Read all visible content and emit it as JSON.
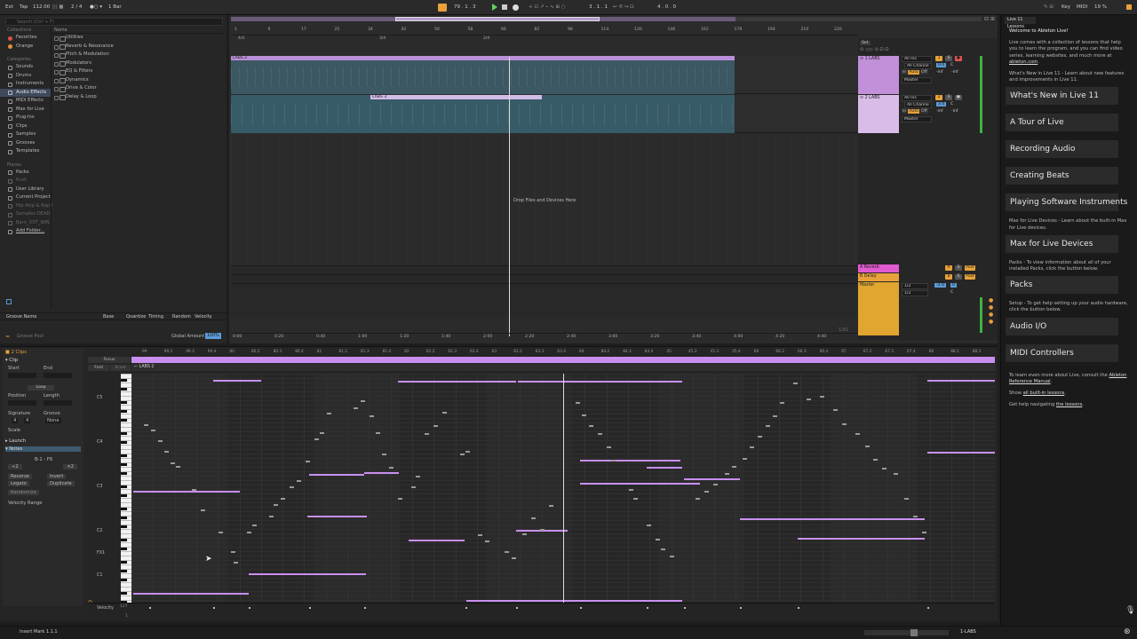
{
  "topbar": {
    "ext": "Ext",
    "tap": "Tap",
    "tempo": "112.00",
    "sig": "2 / 4",
    "quant": "1 Bar",
    "pos": "79 .  1 .  3",
    "loop_pos": "3 .  1 .  1",
    "loop_len": "4 .  0 .  0",
    "key": "Key",
    "midi": "MIDI",
    "cpu": "19 %"
  },
  "browser": {
    "search_placeholder": "Search (Ctrl + F)",
    "collections_h": "Collections",
    "collections": [
      {
        "label": "Favorites",
        "color": "#e05050"
      },
      {
        "label": "Orange",
        "color": "#e0903a"
      }
    ],
    "categories_h": "Categories",
    "categories": [
      "Sounds",
      "Drums",
      "Instruments",
      "Audio Effects",
      "MIDI Effects",
      "Max for Live",
      "Plug-Ins",
      "Clips",
      "Samples",
      "Grooves",
      "Templates"
    ],
    "places_h": "Places",
    "places": [
      "Packs",
      "Push",
      "User Library",
      "Current Project",
      "Hip-Hop & Rap I",
      "Samples DEADI",
      "Barn_VST_WIN",
      "Add Folder..."
    ],
    "name_h": "Name",
    "tree": [
      "Utilities",
      "Reverb & Resonance",
      "Pitch & Modulation",
      "Modulators",
      "EQ & Filters",
      "Dynamics",
      "Drive & Color",
      "Delay & Loop"
    ],
    "groove_cols": [
      "Groove Name",
      "Base",
      "Quantize",
      "Timing",
      "Random",
      "Velocity"
    ],
    "groove_pool": "Groove Pool",
    "global_amount_label": "Global Amount",
    "global_amount": "100%"
  },
  "arrangement": {
    "ruler": [
      "1",
      "9",
      "17",
      "25",
      "34",
      "42",
      "50",
      "58",
      "66",
      "82",
      "96",
      "114",
      "130",
      "146",
      "162",
      "178",
      "194",
      "210",
      "226"
    ],
    "markers": [
      "4/4",
      "3/4",
      "2/4"
    ],
    "time_ruler": [
      "0:00",
      "0:20",
      "0:40",
      "1:00",
      "1:20",
      "1:40",
      "2:00",
      "2:20",
      "2:40",
      "3:00",
      "3:20",
      "3:40",
      "4:00",
      "4:20",
      "4:40"
    ],
    "end_ratio": "1/81",
    "clip1": "LABS 2",
    "clip2": "LABS 3",
    "drop": "Drop Files and Devices Here",
    "set": "Set",
    "tracks": [
      {
        "name": "1 LABS",
        "in": "All Ins",
        "ch": "All Channe",
        "mon": "In",
        "mon2": "Auto",
        "mon3": "Off",
        "out": "Master",
        "vol": "0.0",
        "pan": "C",
        "n1": "-inf",
        "n2": "-inf",
        "num": "1",
        "s": "S"
      },
      {
        "name": "2 LABS",
        "in": "All Ins",
        "ch": "All Channe",
        "mon": "In",
        "mon2": "Auto",
        "mon3": "Off",
        "out": "Master",
        "vol": "3.0",
        "pan": "C",
        "n1": "-inf",
        "n2": "-inf",
        "num": "2",
        "s": "S"
      }
    ],
    "returns": [
      {
        "name": "A Reverb",
        "l": "A",
        "s": "S",
        "p": "Post"
      },
      {
        "name": "B Delay",
        "l": "B",
        "s": "S",
        "p": "Post"
      }
    ],
    "master": {
      "name": "Master",
      "cue1": "1/2",
      "cue2": "1/2",
      "vol": "-2.0",
      "val": "0",
      "pan": "C"
    }
  },
  "lessons": {
    "title": "Live 11 Lessons",
    "welcome": "Welcome to Ableton Live!",
    "intro1": "Live comes with a collection of lessons that help you to learn the program, and you can find video series, learning websites, and much more at",
    "intro_link": "ableton.com",
    "whatsnew_desc": "What's New in Live 11 - Learn about new features and improvements in Live 11.",
    "buttons1": [
      "What's New in Live 11",
      "A Tour of Live",
      "Recording Audio",
      "Creating Beats",
      "Playing Software Instruments"
    ],
    "m4l_desc": "Max for Live Devices - Learn about the built-in Max for Live devices.",
    "m4l_btn": "Max for Live Devices",
    "packs_desc": "Packs - To view information about all of your installed Packs, click the button below.",
    "packs_btn": "Packs",
    "setup_desc": "Setup - To get help setting up your audio hardware, click the button below.",
    "setup_btns": [
      "Audio I/O",
      "MIDI Controllers"
    ],
    "more1": "To learn even more about Live, consult the",
    "manual": "Ableton Reference Manual",
    "show": "Show",
    "all_lessons": "all built-in lessons",
    "help": "Get help navigating",
    "the_lessons": "the lessons"
  },
  "detail": {
    "clips": "2 Clips",
    "clip": "Clip",
    "start": "Start",
    "end": "End",
    "loop": "Loop",
    "position": "Position",
    "length": "Length",
    "signature": "Signature",
    "groove": "Groove",
    "sig_n": "4",
    "sig_d": "4",
    "groove_v": "None",
    "scale": "Scale",
    "launch": "Launch",
    "notes": "Notes",
    "range": "B-1 - F6",
    "reverse": "Reverse",
    "invert": "Invert",
    "legato": "Legato",
    "duplicate": "Duplicate",
    "randomize": "Randomize",
    "vel_range": "Velocity Range",
    "focus": "Focus",
    "fold": "Fold",
    "scale_btn": "Scale",
    "clip_name": "LABS 2",
    "keys": [
      "C5",
      "C4",
      "C3",
      "C2",
      "FX1",
      "C1"
    ],
    "vel_label": "Velocity",
    "vel_max": "127",
    "vel_min": "1",
    "ruler": [
      "99",
      "99.2",
      "99.3",
      "99.4",
      "80",
      "80.2",
      "80.3",
      "80.4",
      "81",
      "81.2",
      "81.3",
      "81.4",
      "62",
      "62.2",
      "62.3",
      "62.4",
      "63",
      "63.2",
      "63.3",
      "63.4",
      "84",
      "84.2",
      "84.3",
      "84.4",
      "45",
      "45.2",
      "45.3",
      "45.4",
      "66",
      "66.2",
      "66.3",
      "66.4",
      "67",
      "67.2",
      "67.3",
      "67.4",
      "88",
      "88.2",
      "88.3"
    ]
  },
  "status": {
    "left": "Insert Mark 1.1.1",
    "right": "1-LABS"
  }
}
